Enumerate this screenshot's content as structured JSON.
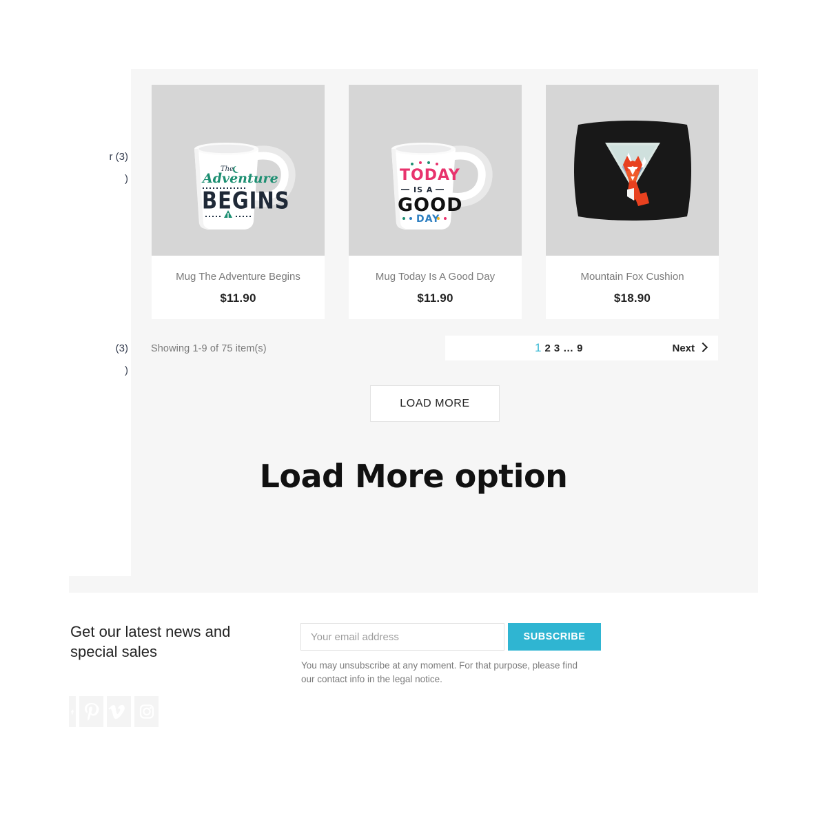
{
  "theme": {
    "accent": "#2fb5d2",
    "band_bg": "#f6f6f6",
    "thumb_bg": "#d6d6d6",
    "card_bg": "#ffffff",
    "muted_text": "#7a7a7a",
    "dark_text": "#232323"
  },
  "sidebar": {
    "fragments": [
      {
        "text": "r (3)"
      },
      {
        "text": ")"
      },
      {
        "text": "(3)"
      },
      {
        "text": ")"
      }
    ]
  },
  "products": [
    {
      "title": "Mug The Adventure Begins",
      "price": "$11.90",
      "image_name": "mug-adventure-begins-image"
    },
    {
      "title": "Mug Today Is A Good Day",
      "price": "$11.90",
      "image_name": "mug-today-good-day-image"
    },
    {
      "title": "Mountain Fox Cushion",
      "price": "$18.90",
      "image_name": "mountain-fox-cushion-image"
    }
  ],
  "results": {
    "showing_text": "Showing 1-9 of 75 item(s)",
    "range_start": 1,
    "range_end": 9,
    "total_items": 75
  },
  "pagination": {
    "pages": [
      "1",
      "2",
      "3"
    ],
    "ellipsis": "…",
    "last_page": "9",
    "current_page": "1",
    "next_label": "Next"
  },
  "load_more": {
    "button_label": "LOAD MORE"
  },
  "section": {
    "heading": "Load More option"
  },
  "newsletter": {
    "title": "Get our latest news and special sales",
    "email_placeholder": "Your email address",
    "email_value": "",
    "subscribe_label": "SUBSCRIBE",
    "note": "You may unsubscribe at any moment. For that purpose, please find our contact info in the legal notice."
  },
  "social": {
    "icons": [
      "facebook-icon",
      "pinterest-icon",
      "vimeo-icon",
      "instagram-icon"
    ]
  }
}
